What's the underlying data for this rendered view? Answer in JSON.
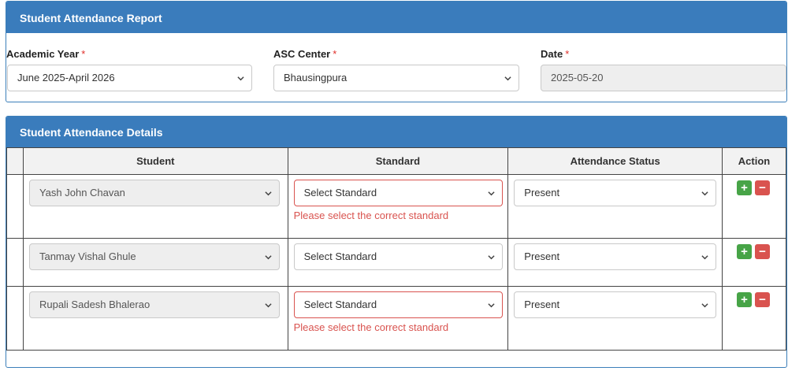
{
  "report_panel": {
    "title": "Student Attendance Report",
    "academic_year": {
      "label": "Academic Year",
      "required": "*",
      "value": "June 2025-April 2026"
    },
    "asc_center": {
      "label": "ASC Center",
      "required": "*",
      "value": "Bhausingpura"
    },
    "date": {
      "label": "Date",
      "required": "*",
      "value": "2025-05-20"
    }
  },
  "details_panel": {
    "title": "Student Attendance Details",
    "columns": [
      "Student",
      "Standard",
      "Attendance Status",
      "Action"
    ],
    "rows": [
      {
        "student": "Yash John Chavan",
        "standard": "Select Standard",
        "error": "Please select the correct standard",
        "status": "Present"
      },
      {
        "student": "Tanmay Vishal Ghule",
        "standard": "Select Standard",
        "error": "",
        "status": "Present"
      },
      {
        "student": "Rupali Sadesh Bhalerao",
        "standard": "Select Standard",
        "error": "Please select the correct standard",
        "status": "Present"
      }
    ],
    "actions": {
      "add": "+",
      "remove": "−"
    }
  },
  "icons": {
    "select_arrow": "chevron-down-icon",
    "add": "plus-icon",
    "remove": "minus-icon"
  },
  "colors": {
    "header_blue": "#3a7cbc",
    "error_red": "#d9534f",
    "add_green": "#47a447"
  }
}
